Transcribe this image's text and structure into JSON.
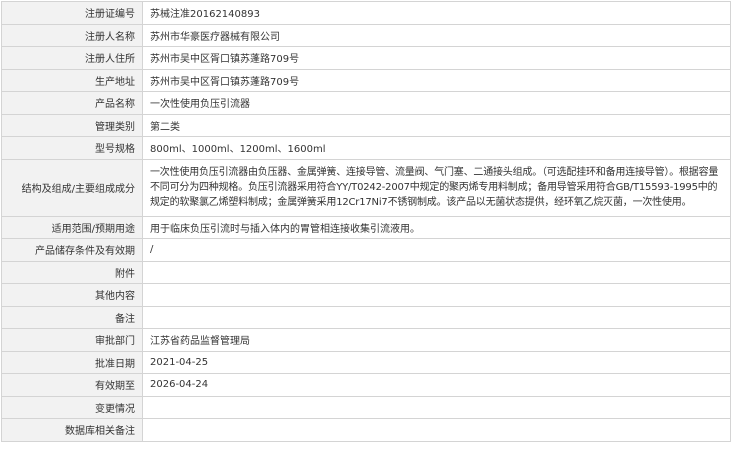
{
  "rows": [
    {
      "label": "注册证编号",
      "value": "苏械注准20162140893"
    },
    {
      "label": "注册人名称",
      "value": "苏州市华豪医疗器械有限公司"
    },
    {
      "label": "注册人住所",
      "value": "苏州市吴中区胥口镇苏蓬路709号"
    },
    {
      "label": "生产地址",
      "value": "苏州市吴中区胥口镇苏蓬路709号"
    },
    {
      "label": "产品名称",
      "value": "一次性使用负压引流器"
    },
    {
      "label": "管理类别",
      "value": "第二类"
    },
    {
      "label": "型号规格",
      "value": "800ml、1000ml、1200ml、1600ml"
    },
    {
      "label": "结构及组成/主要组成成分",
      "value": "一次性使用负压引流器由负压器、金属弹簧、连接导管、流量阀、气门塞、二通接头组成。（可选配挂环和备用连接导管）。根据容量不同可分为四种规格。负压引流器采用符合YY/T0242-2007中规定的聚丙烯专用料制成；备用导管采用符合GB/T15593-1995中的规定的软聚氯乙烯塑料制成；金属弹簧采用12Cr17Ni7不锈钢制成。该产品以无菌状态提供，经环氧乙烷灭菌，一次性使用。"
    },
    {
      "label": "适用范围/预期用途",
      "value": "用于临床负压引流时与插入体内的胃管相连接收集引流液用。"
    },
    {
      "label": "产品储存条件及有效期",
      "value": "/"
    },
    {
      "label": "附件",
      "value": ""
    },
    {
      "label": "其他内容",
      "value": ""
    },
    {
      "label": "备注",
      "value": ""
    },
    {
      "label": "审批部门",
      "value": "江苏省药品监督管理局"
    },
    {
      "label": "批准日期",
      "value": "2021-04-25"
    },
    {
      "label": "有效期至",
      "value": "2026-04-24"
    },
    {
      "label": "变更情况",
      "value": ""
    },
    {
      "label": "数据库相关备注",
      "value": ""
    }
  ]
}
